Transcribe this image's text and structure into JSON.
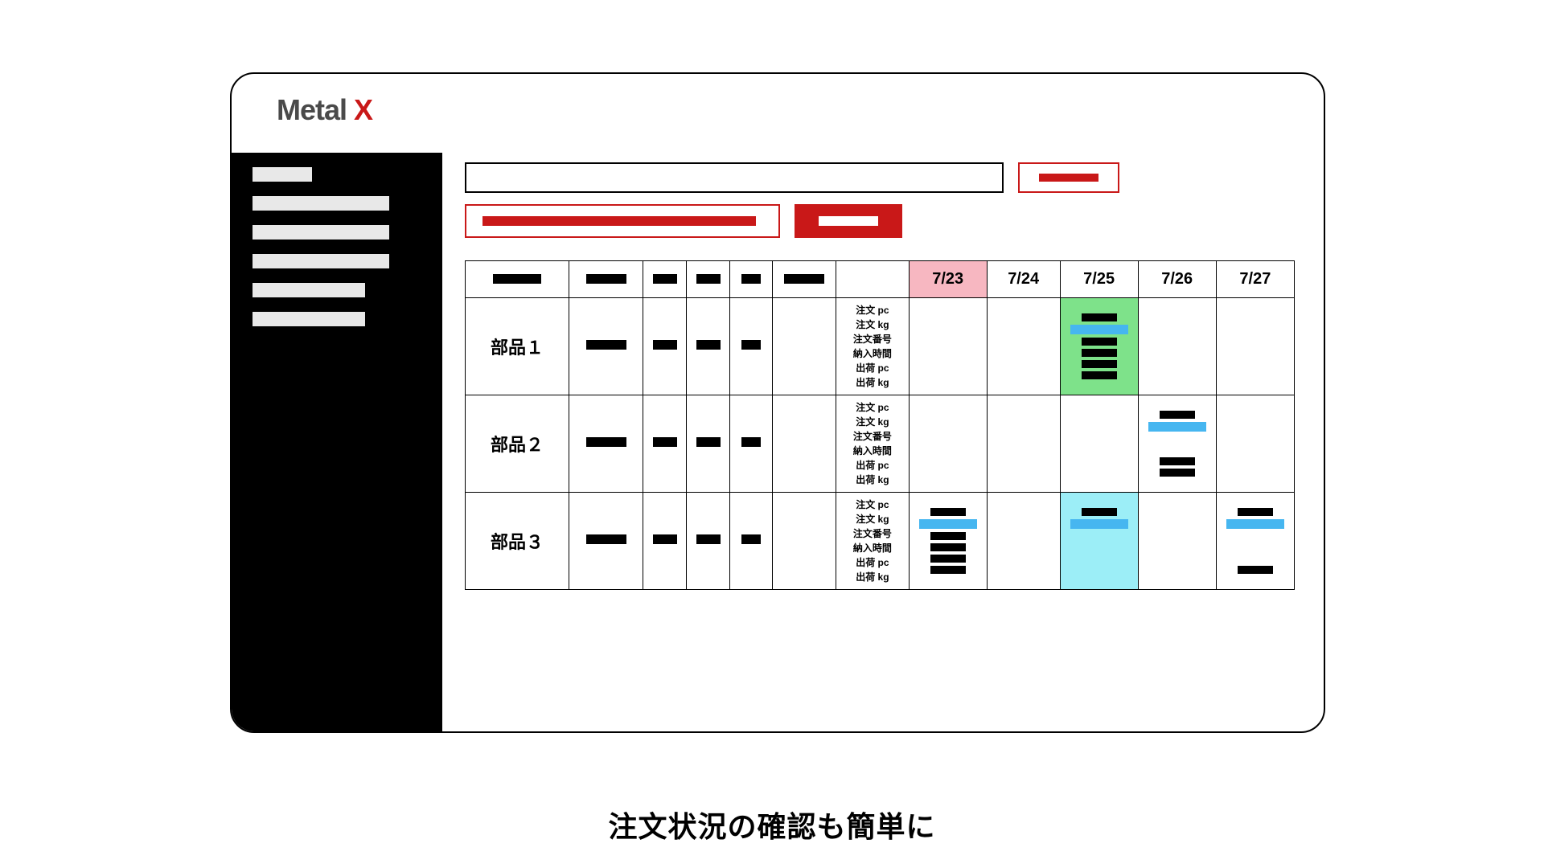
{
  "logo": {
    "brand": "Metal",
    "accent": "X"
  },
  "sidebar": {
    "items": [
      {
        "label": "—",
        "size": "short"
      },
      {
        "label": "—",
        "size": "long"
      },
      {
        "label": "—",
        "size": "long"
      },
      {
        "label": "—",
        "size": "long"
      },
      {
        "label": "—",
        "size": "med"
      },
      {
        "label": "—",
        "size": "med"
      }
    ]
  },
  "toolbar": {
    "search_placeholder": "",
    "search_button_label": "—",
    "filter_input_value": "—",
    "confirm_button_label": "—"
  },
  "dates": {
    "headers": [
      "7/23",
      "7/24",
      "7/25",
      "7/26",
      "7/27"
    ],
    "today_index": 0
  },
  "meta_cols": [
    "—",
    "—",
    "—",
    "—",
    "—",
    "—"
  ],
  "sublabels": [
    "注文 pc",
    "注文 kg",
    "注文番号",
    "納入時間",
    "出荷 pc",
    "出荷 kg"
  ],
  "rows": [
    {
      "part": "部品１",
      "days": [
        {
          "hl": null,
          "bars": []
        },
        {
          "hl": null,
          "bars": []
        },
        {
          "hl": "green",
          "bars": [
            "n",
            "hl",
            "n",
            "n",
            "n",
            "n"
          ]
        },
        {
          "hl": null,
          "bars": []
        },
        {
          "hl": null,
          "bars": []
        }
      ]
    },
    {
      "part": "部品２",
      "days": [
        {
          "hl": null,
          "bars": []
        },
        {
          "hl": null,
          "bars": []
        },
        {
          "hl": null,
          "bars": []
        },
        {
          "hl": null,
          "bars": [
            "n",
            "hl",
            "",
            "",
            "n",
            "n"
          ]
        },
        {
          "hl": null,
          "bars": []
        }
      ]
    },
    {
      "part": "部品３",
      "days": [
        {
          "hl": null,
          "bars": [
            "n",
            "hl",
            "n",
            "n",
            "n",
            "n"
          ]
        },
        {
          "hl": null,
          "bars": []
        },
        {
          "hl": "cyan",
          "bars": [
            "n",
            "hl",
            "",
            "",
            "",
            ""
          ]
        },
        {
          "hl": null,
          "bars": []
        },
        {
          "hl": null,
          "bars": [
            "n",
            "hl",
            "",
            "",
            "",
            "n"
          ]
        }
      ]
    }
  ],
  "caption": "注文状況の確認も簡単に"
}
